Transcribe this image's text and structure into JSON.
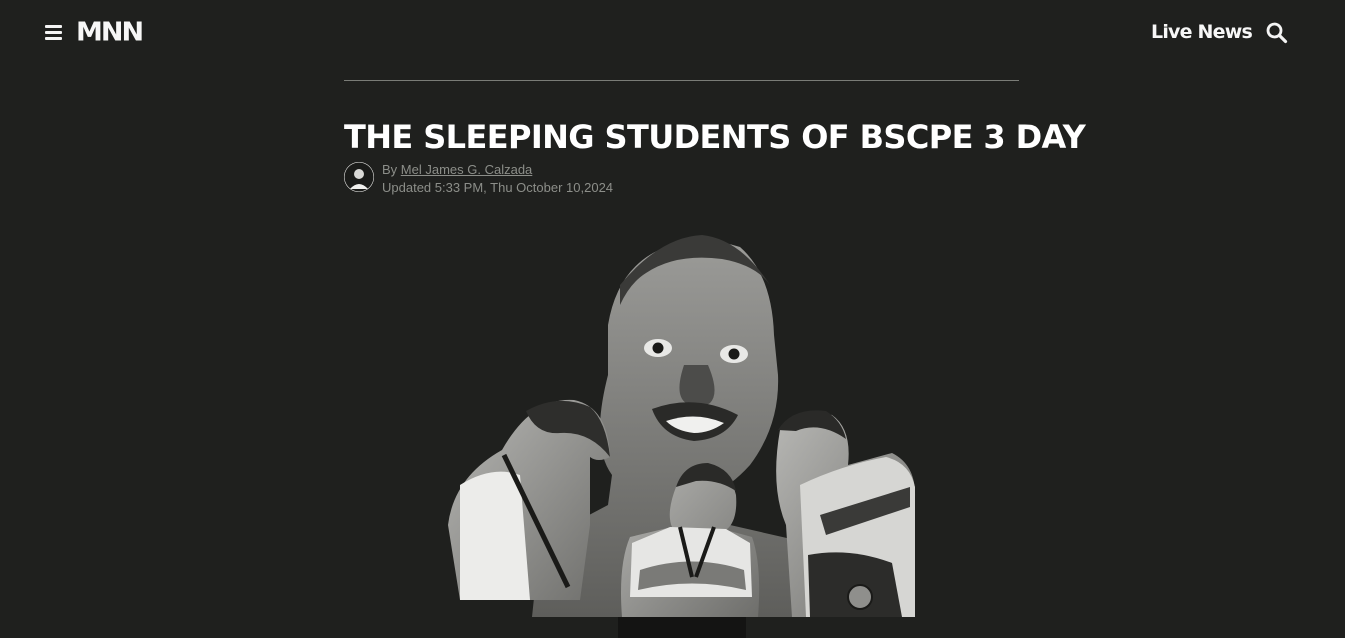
{
  "header": {
    "logo_text": "MNN",
    "live_news_label": "Live News",
    "menu_icon": "hamburger-menu-icon",
    "search_icon": "search-icon"
  },
  "article": {
    "headline": "THE SLEEPING STUDENTS OF BSCPE 3 DAY",
    "by_label": "By",
    "author": "Mel James G. Calzada",
    "updated": "Updated 5:33 PM, Thu October 10,2024"
  },
  "colors": {
    "background": "#1f201e",
    "text": "#ffffff",
    "meta": "#8c8e89",
    "divider": "#7a7c77"
  }
}
